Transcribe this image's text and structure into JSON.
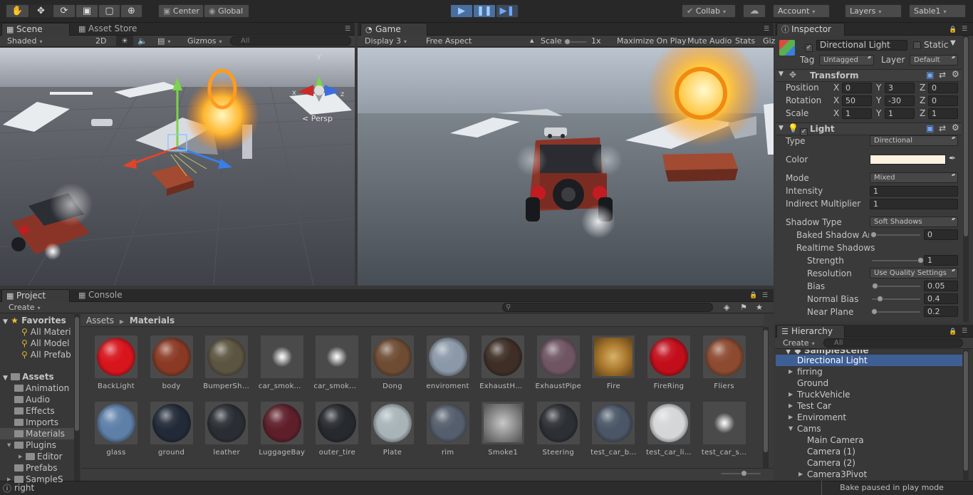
{
  "toolbar": {
    "pivot_center": "Center",
    "pivot_global": "Global",
    "collab": "Collab",
    "account": "Account",
    "layers": "Layers",
    "layout": "Sable1"
  },
  "scene": {
    "tab_label": "Scene",
    "asset_store_tab": "Asset Store",
    "shading": "Shaded",
    "mode_2d": "2D",
    "gizmos": "Gizmos",
    "search_placeholder": "All",
    "persp_label": "< Persp",
    "axis_x": "x",
    "axis_y": "y",
    "axis_z": "z"
  },
  "game": {
    "tab_label": "Game",
    "display": "Display 3",
    "aspect": "Free Aspect",
    "scale_label": "Scale",
    "scale_value": "1x",
    "maximize": "Maximize On Play",
    "mute": "Mute Audio",
    "stats": "Stats",
    "gizmos": "Giz"
  },
  "inspector": {
    "tab_label": "Inspector",
    "object_name": "Directional Light",
    "static_label": "Static",
    "tag_label": "Tag",
    "tag_value": "Untagged",
    "layer_label": "Layer",
    "layer_value": "Default",
    "transform": {
      "title": "Transform",
      "position_label": "Position",
      "rotation_label": "Rotation",
      "scale_label": "Scale",
      "x_label": "X",
      "y_label": "Y",
      "z_label": "Z",
      "position": [
        "0",
        "3",
        "0"
      ],
      "rotation": [
        "50",
        "-30",
        "0"
      ],
      "scale": [
        "1",
        "1",
        "1"
      ]
    },
    "light": {
      "title": "Light",
      "type_label": "Type",
      "type_value": "Directional",
      "color_label": "Color",
      "color_value": "#fdf2e0",
      "mode_label": "Mode",
      "mode_value": "Mixed",
      "intensity_label": "Intensity",
      "intensity_value": "1",
      "indirect_label": "Indirect Multiplier",
      "indirect_value": "1",
      "shadow_type_label": "Shadow Type",
      "shadow_type_value": "Soft Shadows",
      "baked_label": "Baked Shadow Ar",
      "baked_value": "0",
      "baked_level": 0,
      "realtime_label": "Realtime Shadows",
      "strength_label": "Strength",
      "strength_value": "1",
      "strength_level": 1,
      "resolution_label": "Resolution",
      "resolution_value": "Use Quality Settings",
      "bias_label": "Bias",
      "bias_value": "0.05",
      "bias_level": 0.025,
      "normal_bias_label": "Normal Bias",
      "normal_bias_value": "0.4",
      "normal_bias_level": 0.13,
      "near_plane_label": "Near Plane",
      "near_plane_value": "0.2",
      "near_plane_level": 0.02
    }
  },
  "hierarchy": {
    "tab_label": "Hierarchy",
    "create": "Create",
    "search_placeholder": "All",
    "scene_name": "SampleScene",
    "items": [
      {
        "label": "Directional Light",
        "selected": true
      },
      {
        "label": "firring",
        "expandable": true
      },
      {
        "label": "Ground"
      },
      {
        "label": "TruckVehicle",
        "expandable": true
      },
      {
        "label": "Test Car",
        "expandable": true
      },
      {
        "label": "Enviroment",
        "expandable": true
      },
      {
        "label": "Cams",
        "expanded": true
      },
      {
        "label": "Main Camera",
        "indent": 1
      },
      {
        "label": "Camera (1)",
        "indent": 1
      },
      {
        "label": "Camera (2)",
        "indent": 1
      },
      {
        "label": "Camera3Pivot",
        "indent": 1,
        "expandable": true
      }
    ]
  },
  "project": {
    "tab_label": "Project",
    "console_tab": "Console",
    "create": "Create",
    "favorites_label": "Favorites",
    "favorites": [
      "All Materi",
      "All Model",
      "All Prefab"
    ],
    "assets_label": "Assets",
    "folders": [
      "Animation",
      "Audio",
      "Effects",
      "Imports",
      "Materials",
      "Plugins",
      "Editor",
      "Prefabs",
      "SampleS"
    ],
    "breadcrumb_root": "Assets",
    "breadcrumb_current": "Materials",
    "materials": [
      {
        "name": "BackLight",
        "color": "#d8141c"
      },
      {
        "name": "body",
        "color": "#8a3a24"
      },
      {
        "name": "BumperSha…",
        "color": "#5b5440"
      },
      {
        "name": "car_smoke…",
        "color": "glow"
      },
      {
        "name": "car_smoke…",
        "color": "glow"
      },
      {
        "name": "Dong",
        "color": "#6e4c34"
      },
      {
        "name": "enviroment",
        "color": "#8b98a8"
      },
      {
        "name": "ExhaustHo…",
        "color": "#3e2e26"
      },
      {
        "name": "ExhaustPipe",
        "color": "#6f5562"
      },
      {
        "name": "Fire",
        "color": "fire"
      },
      {
        "name": "FireRing",
        "color": "#c20e1a"
      },
      {
        "name": "Fliers",
        "color": "#8c4a30"
      },
      {
        "name": "glass",
        "color": "#5d7fa8"
      },
      {
        "name": "ground",
        "color": "#222a38"
      },
      {
        "name": "leather",
        "color": "#2a2e34"
      },
      {
        "name": "LuggageBay",
        "color": "#5e1e2a"
      },
      {
        "name": "outer_tire",
        "color": "#26292e"
      },
      {
        "name": "Plate",
        "color": "#a8b4b8"
      },
      {
        "name": "rim",
        "color": "#555e6c"
      },
      {
        "name": "Smoke1",
        "color": "smoke"
      },
      {
        "name": "Steering",
        "color": "#2c2f34"
      },
      {
        "name": "test_car_b…",
        "color": "#4a5666"
      },
      {
        "name": "test_car_li…",
        "color": "#d4d6d8"
      },
      {
        "name": "test_car_s…",
        "color": "glow"
      }
    ]
  },
  "status": {
    "message": "right",
    "bake": "Bake paused in play mode"
  }
}
